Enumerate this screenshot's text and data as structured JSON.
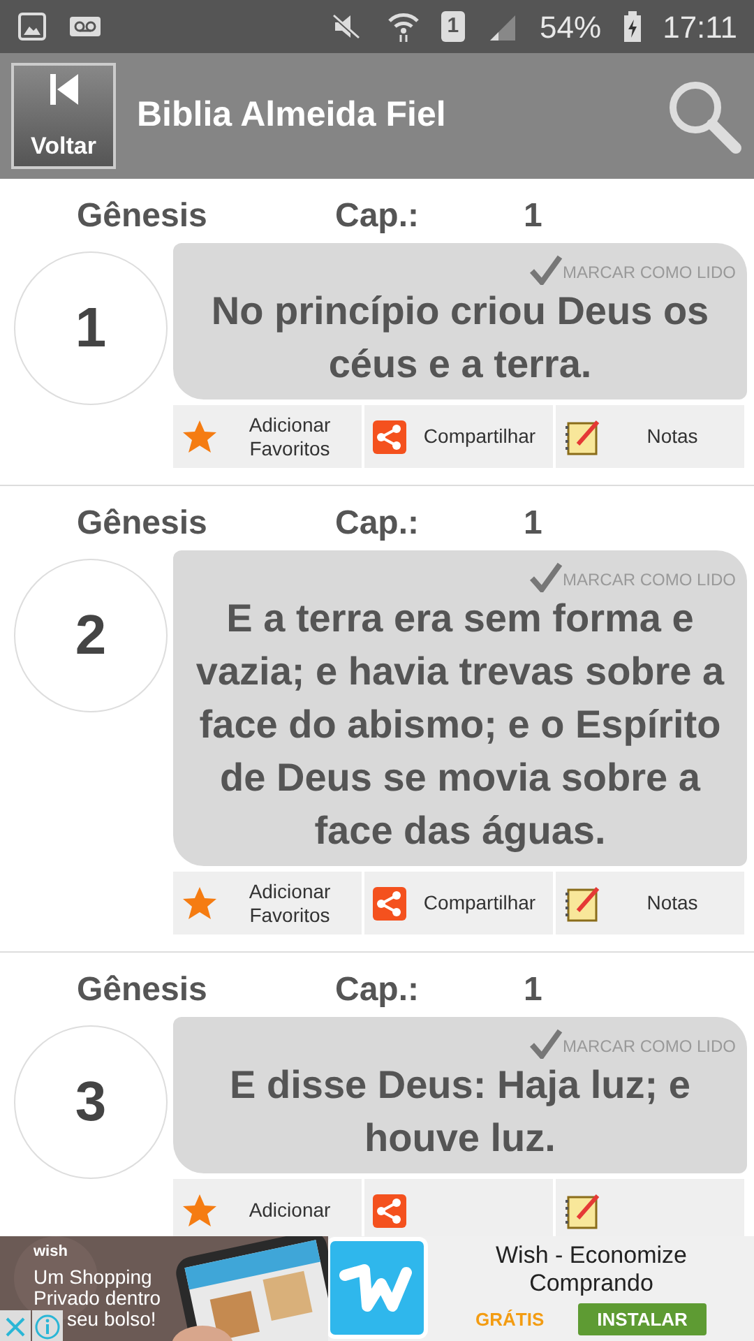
{
  "status_bar": {
    "sim": "1",
    "battery": "54%",
    "time": "17:11"
  },
  "toolbar": {
    "back_label": "Voltar",
    "title": "Biblia Almeida Fiel"
  },
  "verses": [
    {
      "book": "Gênesis",
      "chapter_label": "Cap.:",
      "chapter": "1",
      "number": "1",
      "mark_read": "MARCAR COMO LIDO",
      "text": "No princípio criou Deus os céus e a terra.",
      "actions": [
        {
          "kind": "favorite",
          "label": "Adicionar Favoritos"
        },
        {
          "kind": "share",
          "label": "Compartilhar"
        },
        {
          "kind": "notes",
          "label": "Notas"
        }
      ]
    },
    {
      "book": "Gênesis",
      "chapter_label": "Cap.:",
      "chapter": "1",
      "number": "2",
      "mark_read": "MARCAR COMO LIDO",
      "text": "E a terra era sem forma e vazia; e havia trevas sobre a face do abismo; e o Espírito de Deus se movia sobre a face das águas.",
      "actions": [
        {
          "kind": "favorite",
          "label": "Adicionar Favoritos"
        },
        {
          "kind": "share",
          "label": "Compartilhar"
        },
        {
          "kind": "notes",
          "label": "Notas"
        }
      ]
    },
    {
      "book": "Gênesis",
      "chapter_label": "Cap.:",
      "chapter": "1",
      "number": "3",
      "mark_read": "MARCAR COMO LIDO",
      "text": "E disse Deus: Haja luz; e houve luz.",
      "actions": [
        {
          "kind": "favorite",
          "label": "Adicionar"
        },
        {
          "kind": "share"
        },
        {
          "kind": "notes"
        }
      ]
    }
  ],
  "ad": {
    "brand": "wish",
    "tagline": [
      "Um Shopping",
      "Privado dentro",
      "seu bolso!"
    ],
    "title": "Wish - Economize Comprando",
    "price": "GRÁTIS",
    "install": "INSTALAR"
  }
}
